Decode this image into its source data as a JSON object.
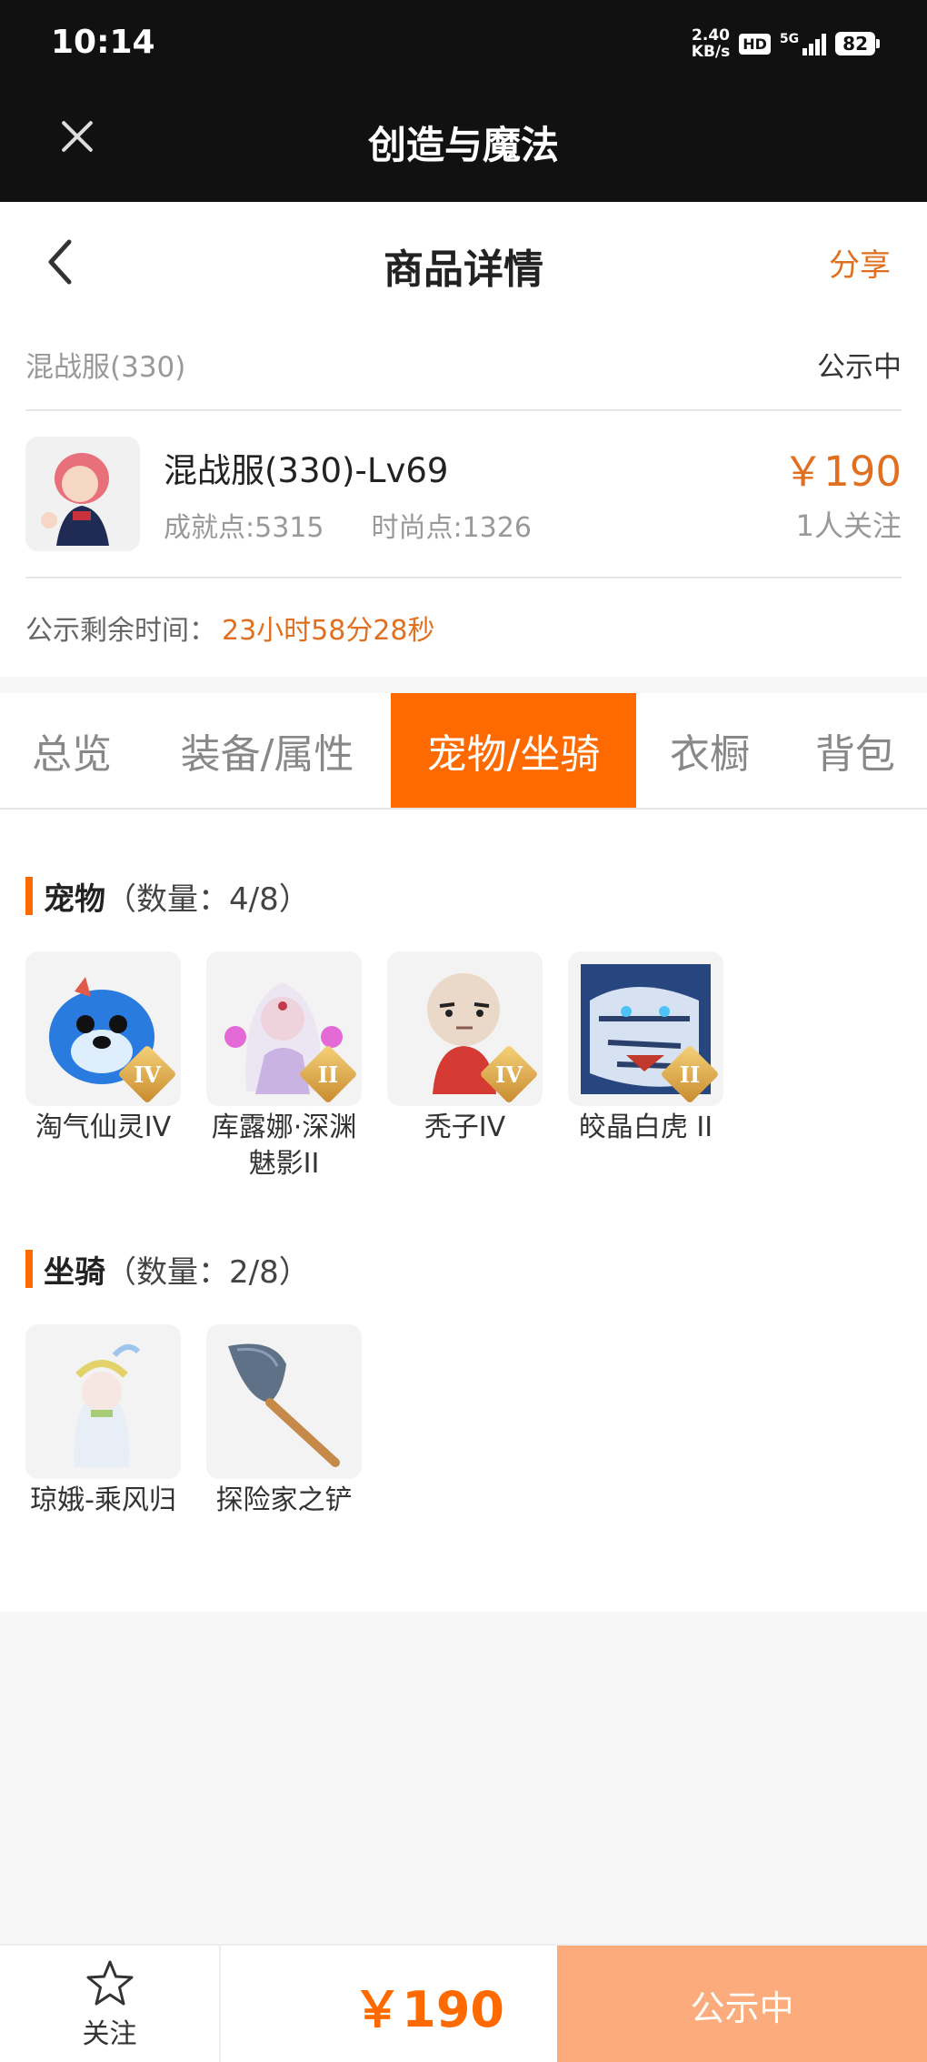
{
  "status_bar": {
    "time": "10:14",
    "net_speed_value": "2.40",
    "net_speed_unit": "KB/s",
    "hd": "HD",
    "network": "5G",
    "battery": "82"
  },
  "app_header": {
    "title": "创造与魔法"
  },
  "nav": {
    "title": "商品详情",
    "share_label": "分享"
  },
  "listing": {
    "server": "混战服(330)",
    "status": "公示中",
    "title": "混战服(330)-Lv69",
    "achievement": "成就点:5315",
    "fashion": "时尚点:1326",
    "price": "￥190",
    "followers": "1人关注",
    "remain_label": "公示剩余时间：",
    "remain_value": "23小时58分28秒"
  },
  "tabs": [
    {
      "label": "总览",
      "active": false
    },
    {
      "label": "装备/属性",
      "active": false
    },
    {
      "label": "宠物/坐骑",
      "active": true
    },
    {
      "label": "衣橱",
      "active": false
    },
    {
      "label": "背包",
      "active": false
    }
  ],
  "pets": {
    "title": "宠物",
    "count": "（数量：4/8）",
    "items": [
      {
        "name": "淘气仙灵IV",
        "tier": "IV",
        "color": "#2a7be0"
      },
      {
        "name": "库露娜·深渊魅影II",
        "tier": "II",
        "color": "#d9c8e8"
      },
      {
        "name": "秃子IV",
        "tier": "IV",
        "color": "#e9cfbd"
      },
      {
        "name": "皎晶白虎 II",
        "tier": "II",
        "color": "#3b5a9c"
      }
    ]
  },
  "mounts": {
    "title": "坐骑",
    "count": "（数量：2/8）",
    "items": [
      {
        "name": "琼娥-乘风归",
        "color": "#e8eef5"
      },
      {
        "name": "探险家之铲",
        "color": "#6b7d92"
      }
    ]
  },
  "bottom": {
    "follow_label": "关注",
    "price": "￥190",
    "cta_label": "公示中"
  }
}
